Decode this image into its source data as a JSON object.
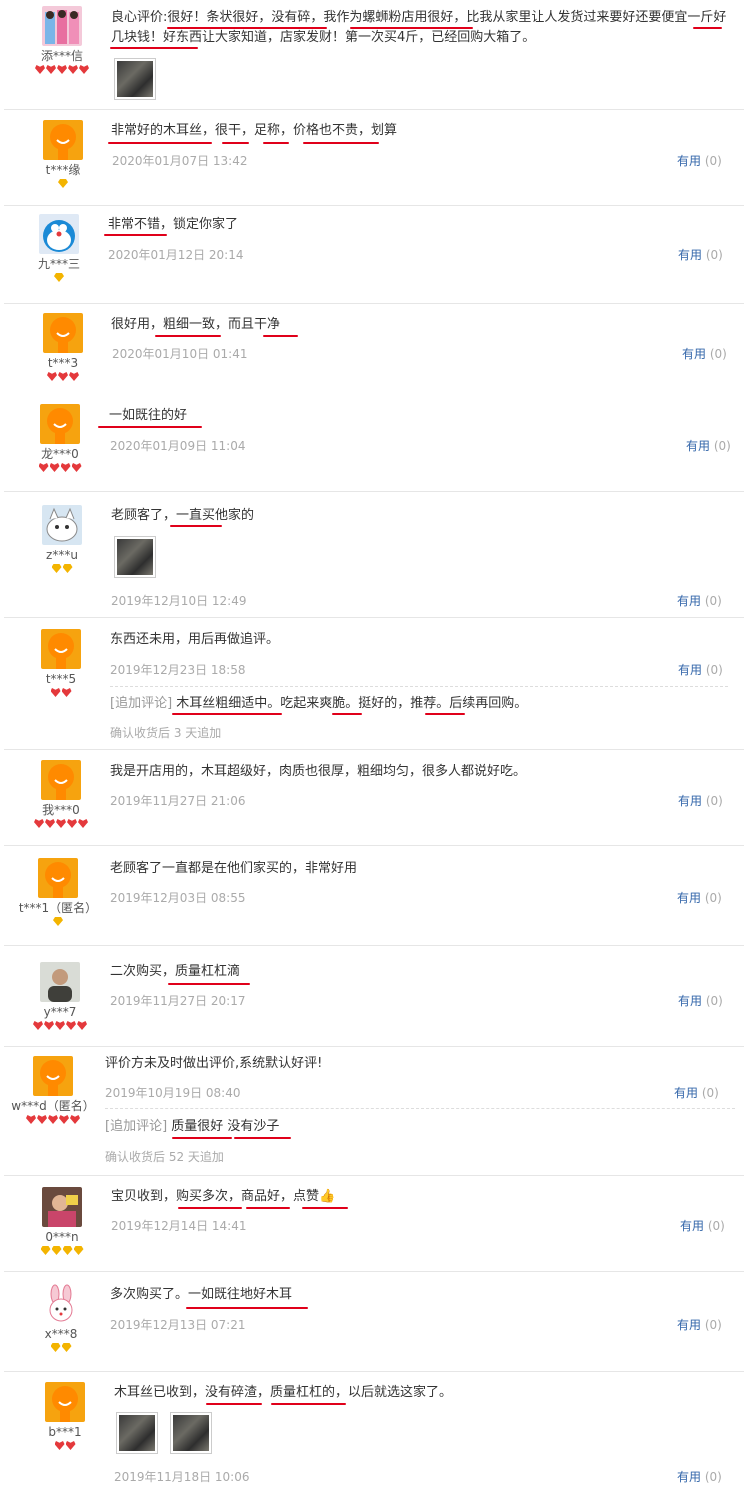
{
  "useful_label": "有用",
  "useful_count": "(0)",
  "addition_tag": "[追加评论]",
  "reviews": [
    {
      "user": "添***信",
      "content": "良心评价:很好！条状很好，没有碎，我作为螺蛳粉店用很好，比我从家里让人发货过来要好还要便宜一斤好几块钱！好东西让大家知道，店家发财！第一次买4斤，已经回购大箱了。",
      "rank": "heart5"
    },
    {
      "user": "t***缘",
      "content": "非常好的木耳丝，很干，足称，价格也不贵，划算",
      "date": "2020年01月07日 13:42",
      "rank": "diamond1"
    },
    {
      "user": "九***三",
      "content": "非常不错，锁定你家了",
      "date": "2020年01月12日 20:14",
      "rank": "diamond1"
    },
    {
      "user": "t***3",
      "content": "很好用，粗细一致，而且干净",
      "date": "2020年01月10日 01:41",
      "rank": "heart3"
    },
    {
      "user": "龙***0",
      "content": "一如既往的好",
      "date": "2020年01月09日 11:04",
      "rank": "heart4"
    },
    {
      "user": "z***u",
      "content": "老顾客了，一直买他家的",
      "date": "2019年12月10日 12:49",
      "rank": "diamond2"
    },
    {
      "user": "t***5",
      "content": "东西还未用，用后再做追评。",
      "date": "2019年12月23日 18:58",
      "addition": "木耳丝粗细适中。吃起来爽脆。挺好的，推荐。后续再回购。",
      "addition_note": "确认收货后 3 天追加",
      "rank": "heart2"
    },
    {
      "user": "我***0",
      "content": "我是开店用的，木耳超级好，肉质也很厚，粗细均匀，很多人都说好吃。",
      "date": "2019年11月27日 21:06",
      "rank": "heart5"
    },
    {
      "user": "t***1（匿名）",
      "content": "老顾客了一直都是在他们家买的，非常好用",
      "date": "2019年12月03日 08:55",
      "rank": "diamond1"
    },
    {
      "user": "y***7",
      "content": "二次购买，质量杠杠滴",
      "date": "2019年11月27日 20:17",
      "rank": "heart5"
    },
    {
      "user": "w***d（匿名）",
      "content": "评价方未及时做出评价,系统默认好评!",
      "date": "2019年10月19日 08:40",
      "addition": "质量很好 没有沙子",
      "addition_note": "确认收货后 52 天追加",
      "rank": "heart5"
    },
    {
      "user": "0***n",
      "content": "宝贝收到，购买多次，商品好，点赞👍",
      "date": "2019年12月14日 14:41",
      "rank": "diamond4"
    },
    {
      "user": "x***8",
      "content": "多次购买了。一如既往地好木耳",
      "date": "2019年12月13日 07:21",
      "rank": "diamond2"
    },
    {
      "user": "b***1",
      "content": "木耳丝已收到，没有碎渣，质量杠杠的，以后就选这家了。",
      "date": "2019年11月18日 10:06",
      "rank": "heart2"
    }
  ],
  "colors": {
    "underline": "#e0001a",
    "useful_link": "#3366aa",
    "meta_gray": "#aaa",
    "heart": "#e4393c",
    "diamond": "#f3b400"
  }
}
